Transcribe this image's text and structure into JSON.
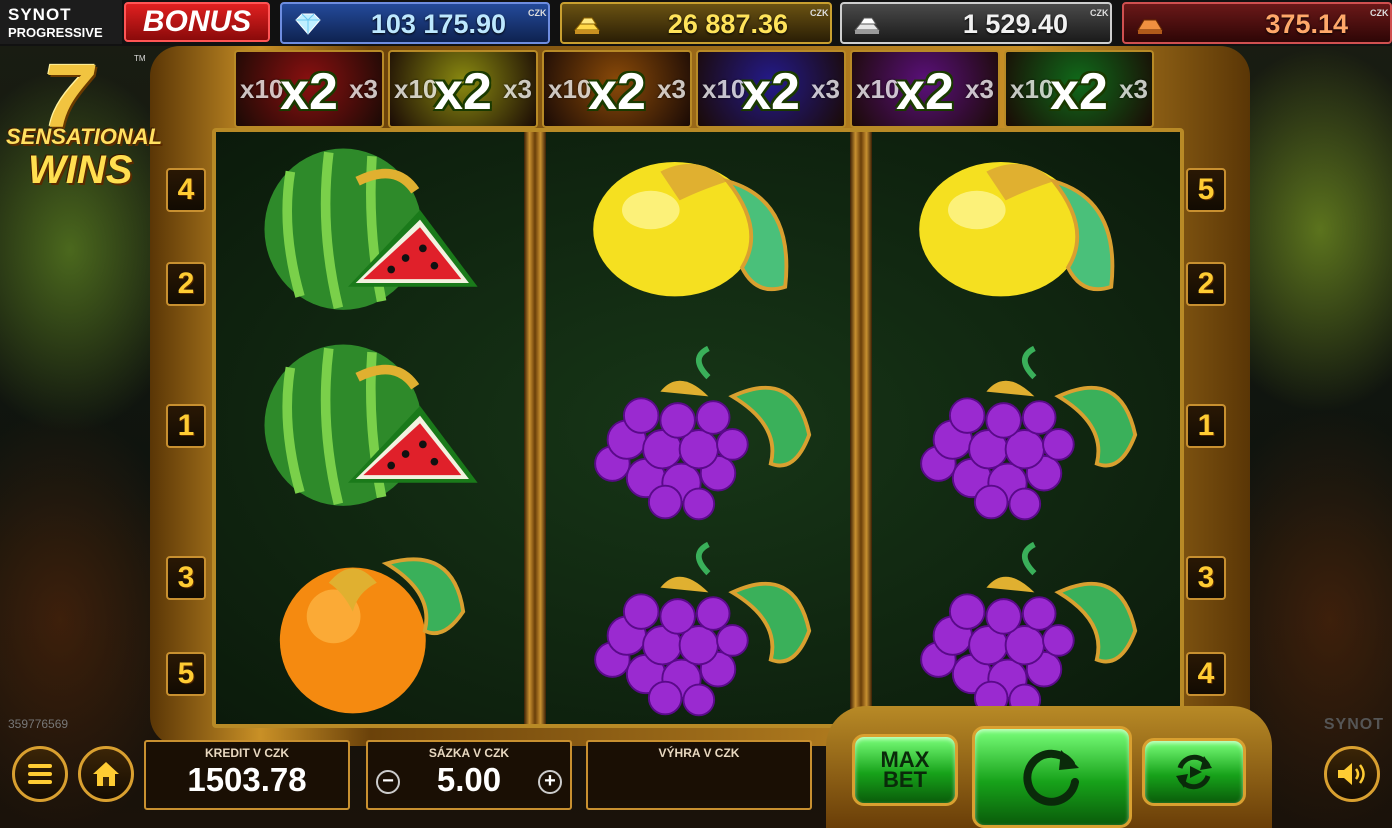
{
  "jackpots": {
    "brand_top": "SYNOT",
    "brand_bottom": "PROGRESSIVE",
    "bonus_label": "BONUS",
    "blue": {
      "value": "103 175.90",
      "currency": "CZK",
      "icon": "diamond-icon"
    },
    "gold": {
      "value": "26 887.36",
      "currency": "CZK",
      "icon": "gold-bars-icon"
    },
    "silver": {
      "value": "1 529.40",
      "currency": "CZK",
      "icon": "silver-bars-icon"
    },
    "bronze": {
      "value": "375.14",
      "currency": "CZK",
      "icon": "bronze-bar-icon"
    }
  },
  "game_logo": {
    "seven": "7",
    "tm": "TM",
    "line1": "SENSATIONAL",
    "line2": "WINS"
  },
  "multipliers": [
    {
      "value": "x2",
      "left": "x10",
      "right": "x3",
      "color": "#8a1010"
    },
    {
      "value": "x2",
      "left": "x10",
      "right": "x3",
      "color": "#8a8a10"
    },
    {
      "value": "x2",
      "left": "x10",
      "right": "x3",
      "color": "#8a4a08"
    },
    {
      "value": "x2",
      "left": "x10",
      "right": "x3",
      "color": "#241a8a"
    },
    {
      "value": "x2",
      "left": "x10",
      "right": "x3",
      "color": "#5a107a"
    },
    {
      "value": "x2",
      "left": "x10",
      "right": "x3",
      "color": "#106a1a"
    }
  ],
  "paylines": {
    "left": [
      "4",
      "2",
      "1",
      "3",
      "5"
    ],
    "right": [
      "5",
      "2",
      "1",
      "3",
      "4"
    ]
  },
  "reels": [
    [
      "watermelon",
      "watermelon",
      "orange"
    ],
    [
      "lemon",
      "grapes",
      "grapes"
    ],
    [
      "lemon",
      "grapes",
      "grapes"
    ]
  ],
  "game_id": "359776569",
  "watermark": "SYNOT",
  "panels": {
    "credit_label": "KREDIT V CZK",
    "credit_value": "1503.78",
    "bet_label": "SÁZKA V CZK",
    "bet_value": "5.00",
    "bet_minus": "−",
    "bet_plus": "+",
    "win_label": "VÝHRA V CZK",
    "win_value": ""
  },
  "buttons": {
    "menu_icon": "menu-icon",
    "home_icon": "home-icon",
    "max_bet_line1": "MAX",
    "max_bet_line2": "BET",
    "spin_icon": "spin-arrow-icon",
    "autoplay_icon": "autoplay-icon",
    "sound_icon": "speaker-icon"
  },
  "colors": {
    "gold_frame": "#c89030",
    "reel_bg": "#173617",
    "button_green": "#17a21a"
  }
}
